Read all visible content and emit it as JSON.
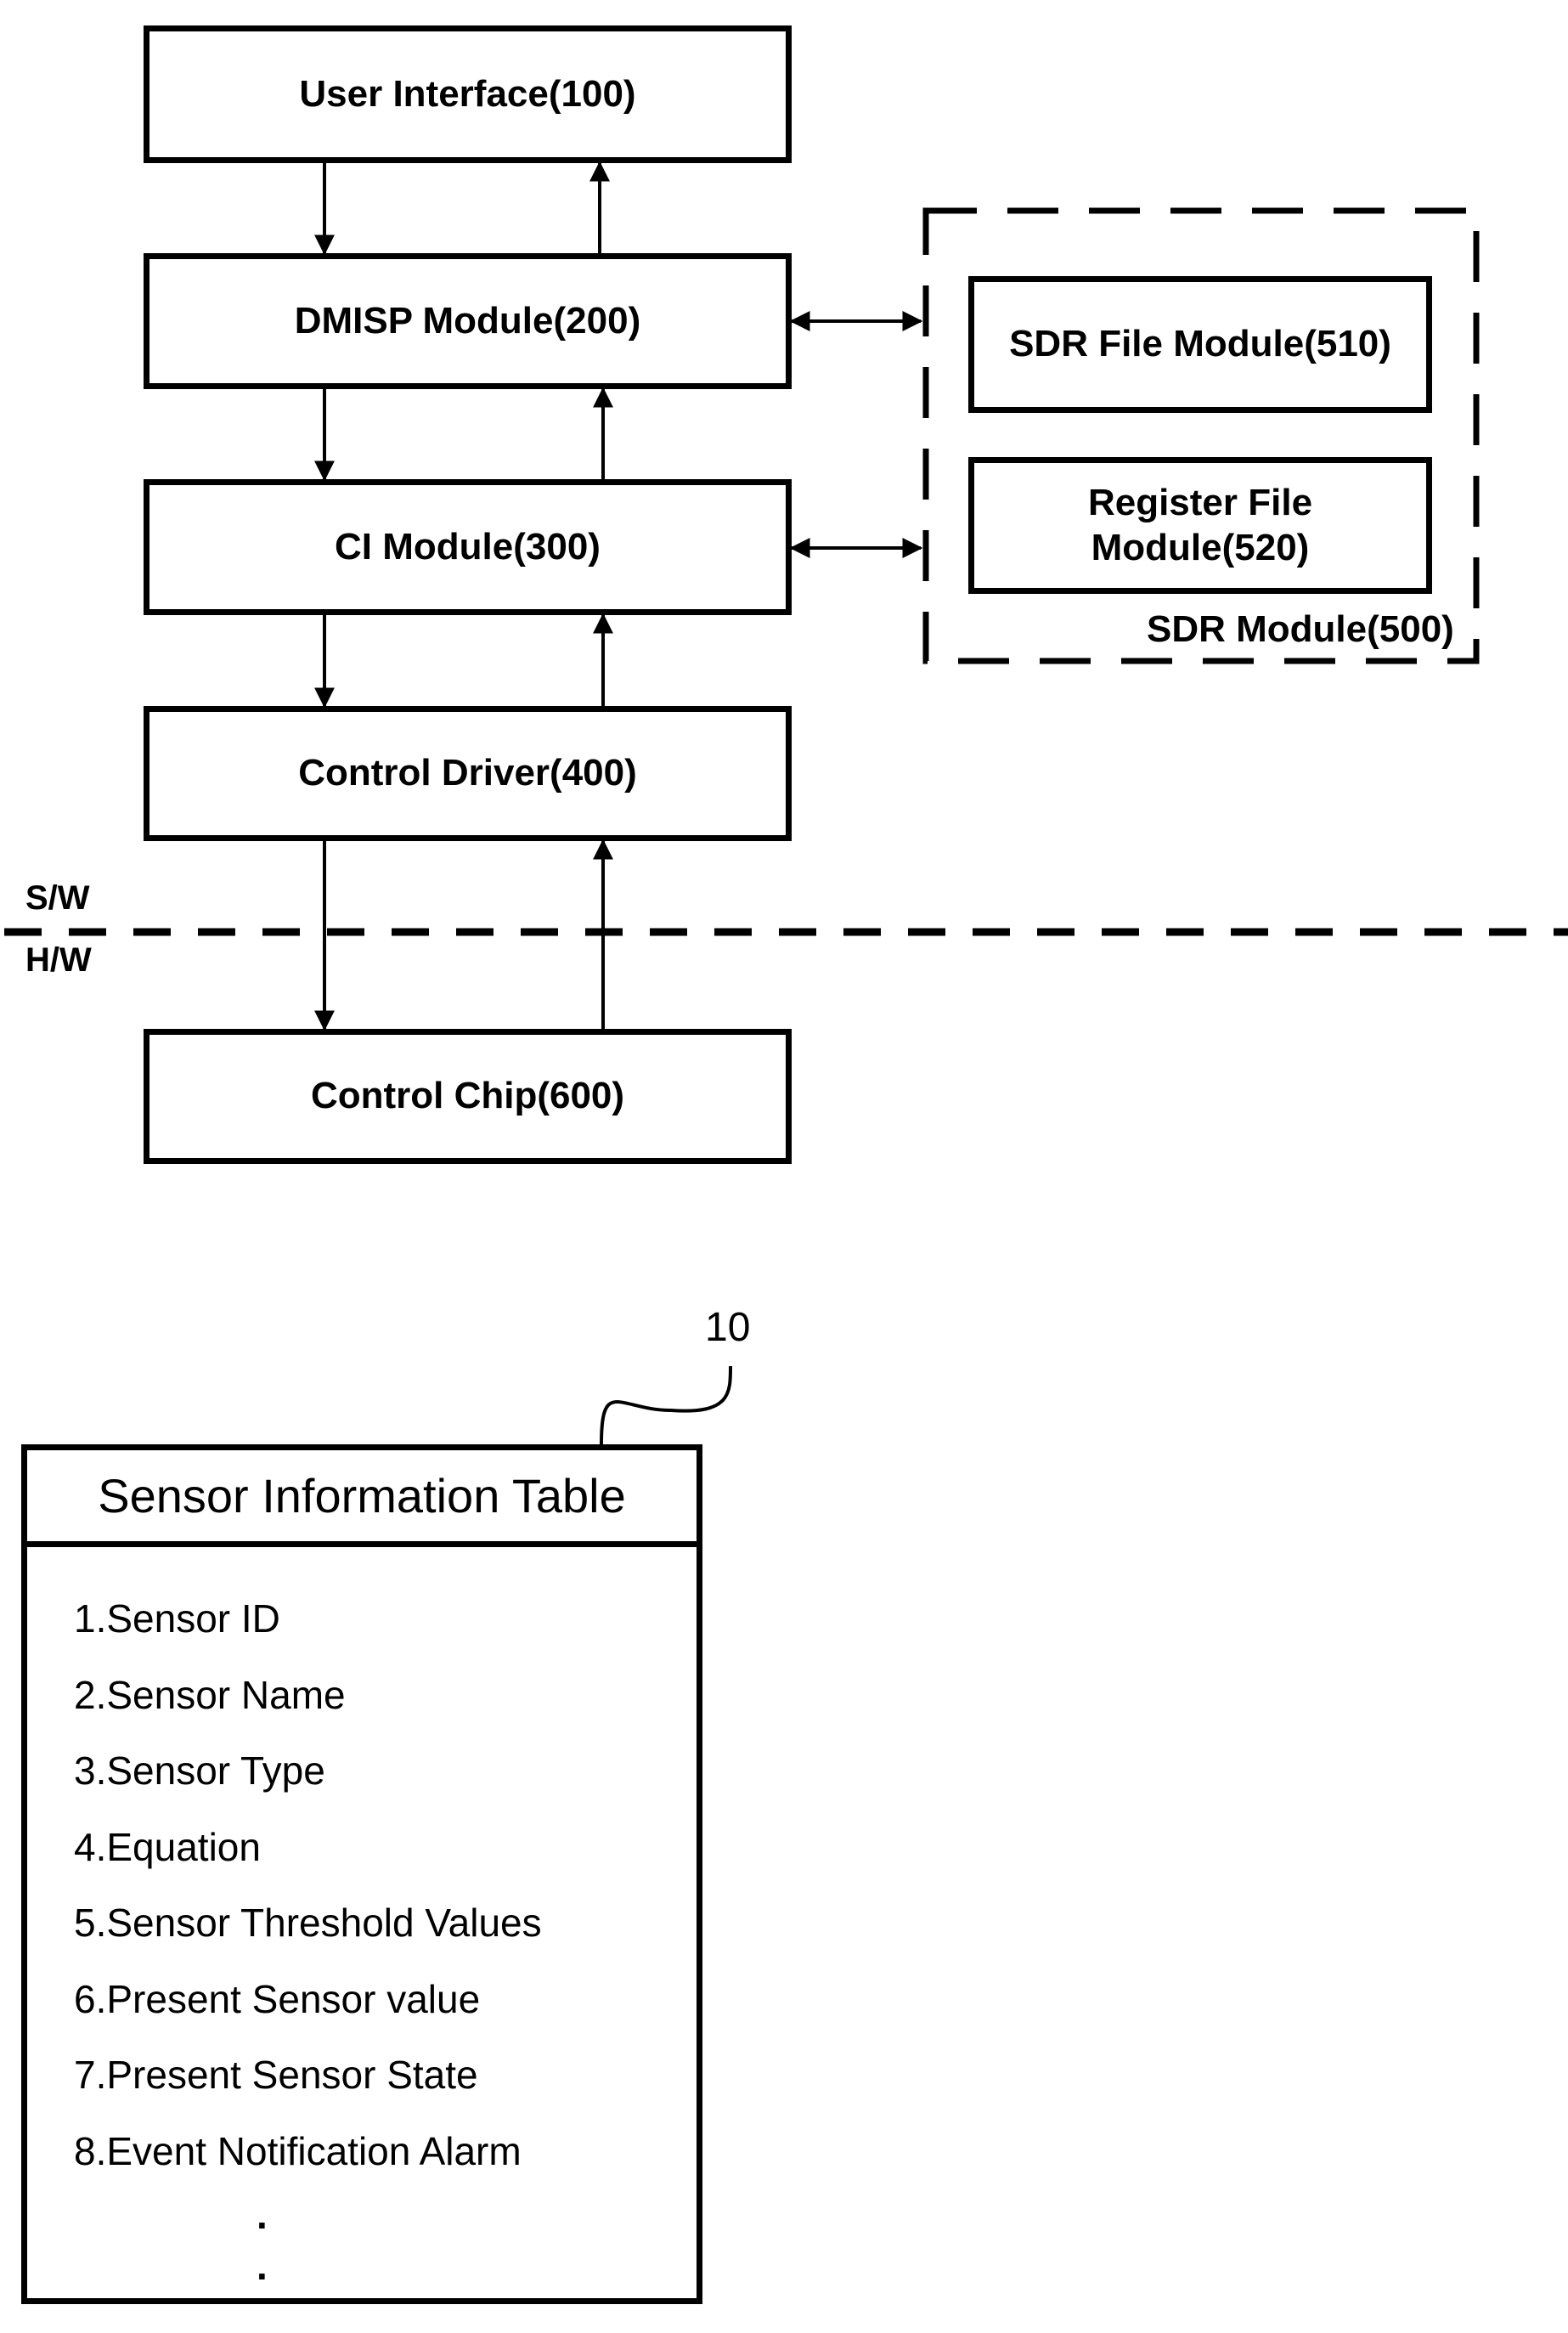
{
  "diagram": {
    "stack": [
      {
        "id": "user-interface",
        "label": "User Interface(100)"
      },
      {
        "id": "dmisp-module",
        "label": "DMISP Module(200)"
      },
      {
        "id": "ci-module",
        "label": "CI Module(300)"
      },
      {
        "id": "control-driver",
        "label": "Control Driver(400)"
      },
      {
        "id": "control-chip",
        "label": "Control Chip(600)"
      }
    ],
    "sdr_group": {
      "label": "SDR Module(500)",
      "children": [
        {
          "id": "sdr-file-module",
          "label": "SDR File Module(510)"
        },
        {
          "id": "register-file-module",
          "label": "Register File Module(520)"
        }
      ]
    },
    "boundary": {
      "upper": "S/W",
      "lower": "H/W"
    }
  },
  "sensor_table": {
    "ref": "10",
    "title": "Sensor Information Table",
    "items": [
      "1.Sensor ID",
      "2.Sensor Name",
      "3.Sensor Type",
      "4.Equation",
      "5.Sensor Threshold Values",
      "6.Present Sensor value",
      "7.Present Sensor State",
      "8.Event Notification Alarm"
    ],
    "continuation": "."
  }
}
